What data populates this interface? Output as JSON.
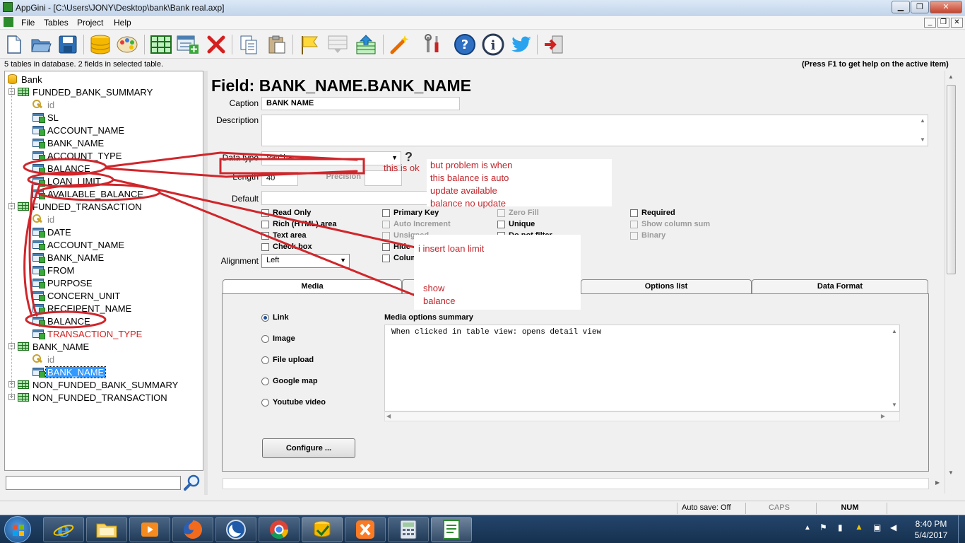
{
  "window": {
    "title": "AppGini - [C:\\Users\\JONY\\Desktop\\bank\\Bank real.axp]",
    "min_label": "▁",
    "max_label": "❐",
    "close_label": "✕"
  },
  "menu": {
    "items": [
      "File",
      "Tables",
      "Project",
      "Help"
    ],
    "mdi_buttons": [
      "_",
      "❐",
      "✕"
    ]
  },
  "toolbar": {
    "icons": [
      "new-file-icon",
      "open-folder-icon",
      "save-icon",
      "database-icon",
      "palette-icon",
      "table-icon",
      "add-field-icon",
      "delete-icon",
      "copy-icon",
      "paste-icon",
      "flag-icon",
      "disabled-icon",
      "upload-icon",
      "magic-wand-icon",
      "tools-icon",
      "help-icon",
      "info-icon",
      "twitter-icon",
      "exit-icon"
    ]
  },
  "infobar": {
    "left": "5 tables in database. 2 fields in selected table.",
    "right": "(Press F1 to get help on the active item)"
  },
  "tree": {
    "root": "Bank",
    "tables": [
      {
        "name": "FUNDED_BANK_SUMMARY",
        "expanded": true,
        "fields": [
          {
            "name": "id",
            "kind": "key"
          },
          {
            "name": "SL",
            "kind": "field"
          },
          {
            "name": "ACCOUNT_NAME",
            "kind": "field"
          },
          {
            "name": "BANK_NAME",
            "kind": "field"
          },
          {
            "name": "ACCOUNT_TYPE",
            "kind": "field"
          },
          {
            "name": "BALANCE",
            "kind": "field"
          },
          {
            "name": "LOAN_LIMIT",
            "kind": "field"
          },
          {
            "name": "AVAILABLE_BALANCE",
            "kind": "field"
          }
        ]
      },
      {
        "name": "FUNDED_TRANSACTION",
        "expanded": true,
        "fields": [
          {
            "name": "id",
            "kind": "key"
          },
          {
            "name": "DATE",
            "kind": "field"
          },
          {
            "name": "ACCOUNT_NAME",
            "kind": "field"
          },
          {
            "name": "BANK_NAME",
            "kind": "field"
          },
          {
            "name": "FROM",
            "kind": "field"
          },
          {
            "name": "PURPOSE",
            "kind": "field"
          },
          {
            "name": "CONCERN_UNIT",
            "kind": "field"
          },
          {
            "name": "RECEIPENT_NAME",
            "kind": "field"
          },
          {
            "name": "BALANCE",
            "kind": "field"
          },
          {
            "name": "TRANSACTION_TYPE",
            "kind": "field",
            "color": "#d42020"
          }
        ]
      },
      {
        "name": "BANK_NAME",
        "expanded": true,
        "fields": [
          {
            "name": "id",
            "kind": "key"
          },
          {
            "name": "BANK_NAME",
            "kind": "field",
            "selected": true
          }
        ]
      },
      {
        "name": "NON_FUNDED_BANK_SUMMARY",
        "expanded": false,
        "fields": []
      },
      {
        "name": "NON_FUNDED_TRANSACTION",
        "expanded": false,
        "fields": []
      }
    ],
    "search_placeholder": ""
  },
  "field": {
    "heading": "Field: BANK_NAME.BANK_NAME",
    "caption_label": "Caption",
    "caption_value": "BANK NAME",
    "description_label": "Description",
    "description_value": "",
    "datatype_label": "Data type",
    "datatype_value": "VarChar",
    "help_mark": "?",
    "length_label": "Length",
    "length_value": "40",
    "precision_label": "Precision",
    "precision_value": "",
    "default_label": "Default",
    "default_value": "",
    "alignment_label": "Alignment",
    "alignment_value": "Left",
    "checkboxes": [
      {
        "label": "Read Only",
        "enabled": true
      },
      {
        "label": "Rich (HTML) area",
        "enabled": true
      },
      {
        "label": "Text area",
        "enabled": true
      },
      {
        "label": "Check box",
        "enabled": true
      },
      {
        "label": "Primary Key",
        "enabled": true
      },
      {
        "label": "Auto Increment",
        "enabled": false
      },
      {
        "label": "Unsigned",
        "enabled": false
      },
      {
        "label": "Hide",
        "enabled": true
      },
      {
        "label": "Column",
        "enabled": true
      },
      {
        "label": "Zero Fill",
        "enabled": false
      },
      {
        "label": "Unique",
        "enabled": true
      },
      {
        "label": "Do not filter",
        "enabled": true
      },
      {
        "label": "Required",
        "enabled": true
      },
      {
        "label": "Show column sum",
        "enabled": false
      },
      {
        "label": "Binary",
        "enabled": false
      }
    ]
  },
  "tabs": [
    {
      "label": "Media",
      "active": true
    },
    {
      "label": "",
      "active": false
    },
    {
      "label": "Options list",
      "active": false
    },
    {
      "label": "Data Format",
      "active": false
    }
  ],
  "media": {
    "options": [
      {
        "label": "Link",
        "checked": true
      },
      {
        "label": "Image",
        "checked": false
      },
      {
        "label": "File upload",
        "checked": false
      },
      {
        "label": "Google map",
        "checked": false
      },
      {
        "label": "Youtube video",
        "checked": false
      }
    ],
    "summary_label": "Media options summary",
    "summary_text": "When clicked in table view: opens detail view",
    "configure_label": "Configure ..."
  },
  "annotations": {
    "ok": "this is ok",
    "problem": [
      "but problem is when",
      "this balance is auto",
      "update available",
      "balance no update"
    ],
    "insert": "i insert loan limit",
    "show": [
      "show",
      "balance"
    ],
    "color": "#d0262b"
  },
  "status": {
    "autosave": "Auto save: Off",
    "caps": "CAPS",
    "num": "NUM"
  },
  "taskbar": {
    "apps": [
      "ie-icon",
      "explorer-icon",
      "media-player-icon",
      "firefox-icon",
      "app-icon",
      "chrome-icon",
      "appgini-icon",
      "xampp-icon",
      "calculator-icon",
      "notepad-icon"
    ],
    "time": "8:40 PM",
    "date": "5/4/2017"
  },
  "colors": {
    "accent": "#3399ff",
    "annotation": "#d0262b",
    "taskbar": "#1c3b5e"
  }
}
